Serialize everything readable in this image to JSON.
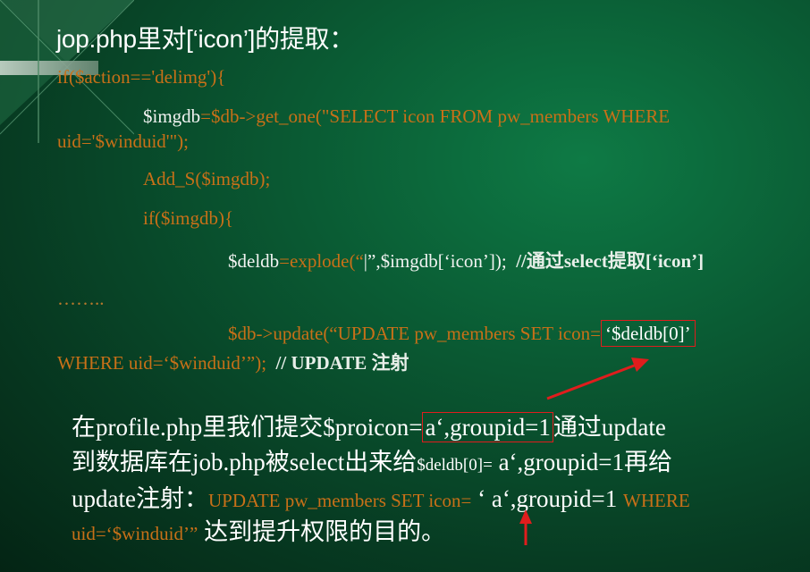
{
  "title": "jop.php里对[‘icon’]的提取：",
  "code": {
    "l1": "if($action=='delimg'){",
    "l2a": "$imgdb",
    "l2b": "=$db->get_one(\"",
    "l2c": "SELECT icon FROM pw_members WHERE",
    "l3": "uid='$winduid'\");",
    "l4": "Add_S($imgdb);",
    "l5": "if($imgdb){",
    "l6a": "$deldb",
    "l6b": "=explode(“",
    "l6c": "|",
    "l6d": "”,$imgdb[‘icon’]);",
    "l6comment": "//通过select提取[‘icon’]",
    "l7": "……..",
    "l8a": "$db->update(“UPDATE pw_members SET icon=",
    "l8b": "‘$deldb[0]’",
    "l9a": "WHERE uid=‘$winduid’”);",
    "l9comment": "// UPDATE 注射"
  },
  "para": {
    "p1a": "在profile.php里我们提交$proicon=",
    "p1b": "a‘,groupid=1",
    "p1c": "通过update",
    "p2a": "到数据库在job.php被select出来给",
    "p2b": "$deldb[0]=",
    "p2c": " a‘,groupid=1再给",
    "p3a": "update注射：",
    "p3b": "UPDATE pw_members SET icon=",
    "p3c": " ‘ a‘,groupid=1 ",
    "p3d": "WHERE",
    "p4a": "uid=‘$winduid’”",
    "p4b": " 达到提升权限的目的。"
  },
  "colors": {
    "background": "#0a5a33",
    "code_orange": "#c87018",
    "highlight_red": "#e01d1d",
    "text_white": "#ffffff"
  }
}
